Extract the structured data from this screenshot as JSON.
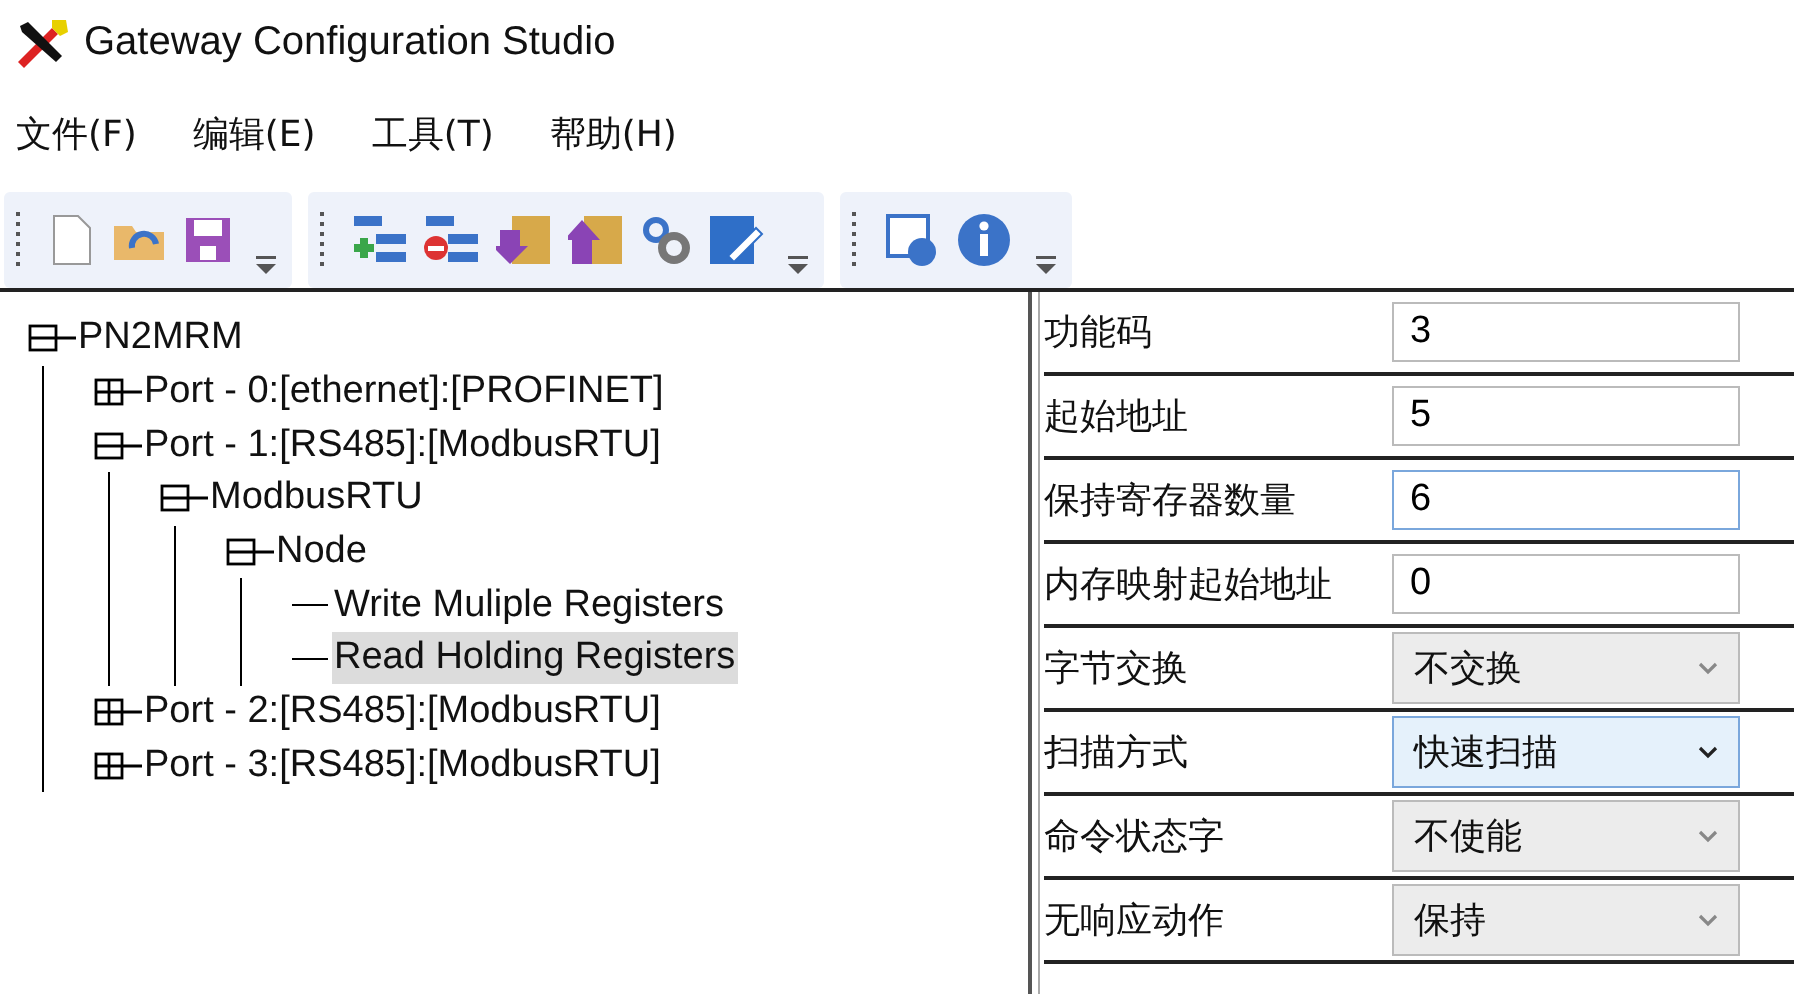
{
  "window": {
    "title": "Gateway Configuration Studio"
  },
  "menu": [
    {
      "label": "文件(F)"
    },
    {
      "label": "编辑(E)"
    },
    {
      "label": "工具(T)"
    },
    {
      "label": "帮助(H)"
    }
  ],
  "tree": [
    {
      "label": "PN2MRM",
      "expanded": true,
      "selected": false,
      "children": [
        {
          "label": "Port - 0:[ethernet]:[PROFINET]",
          "expanded": false,
          "selected": false
        },
        {
          "label": "Port - 1:[RS485]:[ModbusRTU]",
          "expanded": true,
          "selected": false,
          "children": [
            {
              "label": "ModbusRTU",
              "expanded": true,
              "selected": false,
              "children": [
                {
                  "label": "Node",
                  "expanded": true,
                  "selected": false,
                  "children": [
                    {
                      "label": "Write Muliple Registers",
                      "selected": false
                    },
                    {
                      "label": "Read Holding Registers",
                      "selected": true
                    }
                  ]
                }
              ]
            }
          ]
        },
        {
          "label": "Port - 2:[RS485]:[ModbusRTU]",
          "expanded": false,
          "selected": false
        },
        {
          "label": "Port - 3:[RS485]:[ModbusRTU]",
          "expanded": false,
          "selected": false
        }
      ]
    }
  ],
  "properties": [
    {
      "kind": "text",
      "label": "功能码",
      "value": "3",
      "focused": false
    },
    {
      "kind": "text",
      "label": "起始地址",
      "value": "5",
      "focused": false
    },
    {
      "kind": "text",
      "label": "保持寄存器数量",
      "value": "6",
      "focused": true
    },
    {
      "kind": "text",
      "label": "内存映射起始地址",
      "value": "0",
      "focused": false
    },
    {
      "kind": "select",
      "label": "字节交换",
      "value": "不交换",
      "focused": false
    },
    {
      "kind": "select",
      "label": "扫描方式",
      "value": "快速扫描",
      "focused": true
    },
    {
      "kind": "select",
      "label": "命令状态字",
      "value": "不使能",
      "focused": false
    },
    {
      "kind": "select",
      "label": "无响应动作",
      "value": "保持",
      "focused": false
    }
  ]
}
